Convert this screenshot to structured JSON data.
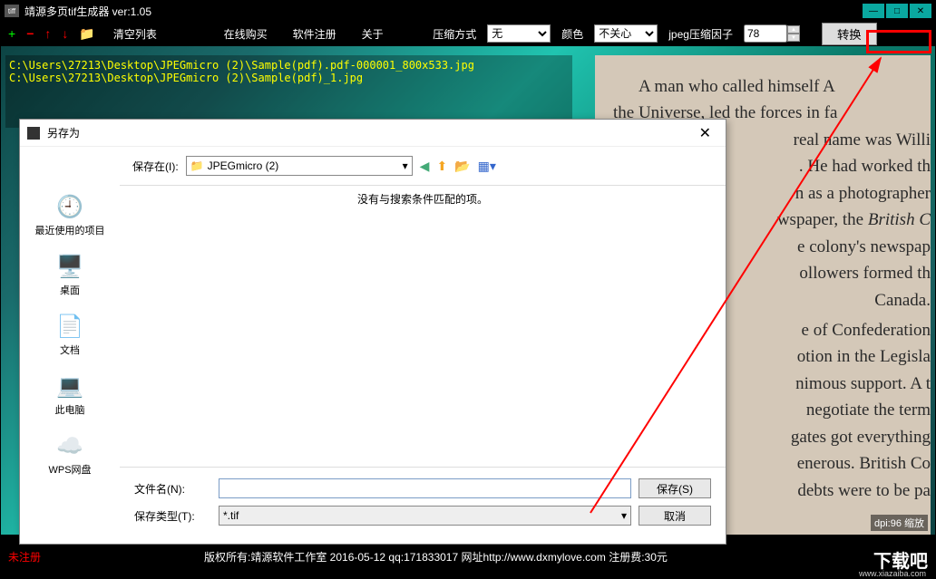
{
  "titlebar": {
    "icon_text": "tiff",
    "title": "靖源多页tif生成器 ver:1.05"
  },
  "toolbar": {
    "clear_list": "清空列表",
    "buy_online": "在线购买",
    "register": "软件注册",
    "about": "关于",
    "compression_label": "压缩方式",
    "compression_value": "无",
    "color_label": "颜色",
    "color_value": "不关心",
    "jpeg_label": "jpeg压缩因子",
    "jpeg_value": "78",
    "convert": "转换"
  },
  "file_list": [
    "C:\\Users\\27213\\Desktop\\JPEGmicro (2)\\Sample(pdf).pdf-000001_800x533.jpg",
    "C:\\Users\\27213\\Desktop\\JPEGmicro (2)\\Sample(pdf)_1.jpg"
  ],
  "preview_text": {
    "p1_l1": "A man who called himself A",
    "p1_l2": "the Universe, led the forces in fa",
    "p1_l3": "real name was Willi",
    "p1_l4": ". He had worked th",
    "p1_l5": "n as a photographer",
    "p1_l6_a": "wspaper, the ",
    "p1_l6_b": "British C",
    "p1_l7": "e colony's newspap",
    "p1_l8": "ollowers formed th",
    "p1_l9": "Canada.",
    "p2_l1": "e of Confederation",
    "p2_l2": "otion in the Legisla",
    "p2_l3": "nimous support. A t",
    "p2_l4": "negotiate the term",
    "p2_l5": "gates got everything",
    "p2_l6": "enerous. British Co",
    "p2_l7": "debts were to be pa"
  },
  "status": {
    "unregistered": "未注册",
    "copyright": "版权所有:靖源软件工作室 2016-05-12 qq:171833017 网址http://www.dxmylove.com 注册费:30元",
    "dpi": "dpi:96 缩放"
  },
  "watermark": {
    "main": "下载吧",
    "url": "www.xiazaiba.com"
  },
  "save_dialog": {
    "title": "另存为",
    "save_in_label": "保存在(I):",
    "save_in_value": "JPEGmicro (2)",
    "no_match": "没有与搜索条件匹配的项。",
    "sidebar": {
      "recent": "最近使用的项目",
      "desktop": "桌面",
      "documents": "文档",
      "this_pc": "此电脑",
      "wps": "WPS网盘"
    },
    "filename_label": "文件名(N):",
    "filename_value": "",
    "filetype_label": "保存类型(T):",
    "filetype_value": "*.tif",
    "save_btn": "保存(S)",
    "cancel_btn": "取消"
  }
}
